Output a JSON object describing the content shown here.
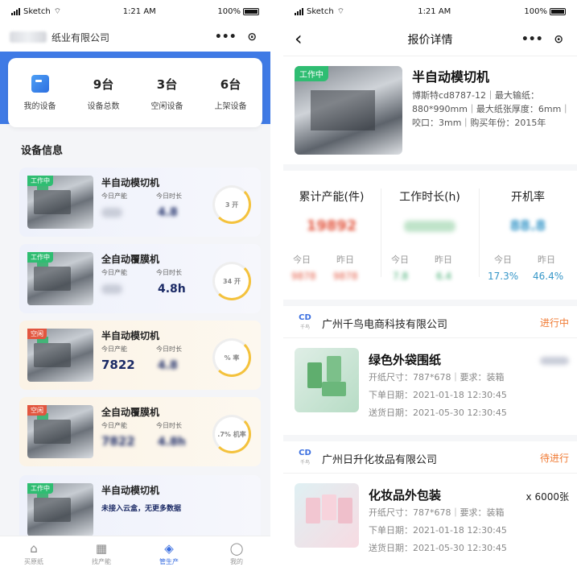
{
  "status": {
    "carrier": "Sketch",
    "time": "1:21 AM",
    "battery": "100%"
  },
  "left": {
    "header": {
      "title": "纸业有限公司",
      "more": "•••",
      "target": "⊙"
    },
    "stats": [
      {
        "num": "",
        "label": "我的设备"
      },
      {
        "num": "9台",
        "label": "设备总数"
      },
      {
        "num": "3台",
        "label": "空闲设备"
      },
      {
        "num": "6台",
        "label": "上架设备"
      }
    ],
    "section_title": "设备信息",
    "devices": [
      {
        "tag": "工作中",
        "name": "半自动模切机",
        "l1": "今日产能",
        "l2": "今日时长",
        "v1": "",
        "v2": "4.8",
        "ring": "3  开"
      },
      {
        "tag": "工作中",
        "name": "全自动覆膜机",
        "l1": "今日产能",
        "l2": "今日时长",
        "v1": "",
        "v2": "4.8h",
        "ring": "34  开"
      },
      {
        "tag": "空闲",
        "name": "半自动模切机",
        "l1": "今日产能",
        "l2": "今日时长",
        "v1": "7822",
        "v2": "4.8",
        "ring": "%  率"
      },
      {
        "tag": "空闲",
        "name": "全自动覆膜机",
        "l1": "今日产能",
        "l2": "今日时长",
        "v1": "7822",
        "v2": "4.8h",
        "ring": ".7%  机率"
      },
      {
        "tag": "工作中",
        "name": "半自动模切机",
        "note": "未接入云盒，无更多数据"
      }
    ],
    "tabs": [
      {
        "icon": "⌂",
        "label": "买原纸"
      },
      {
        "icon": "▦",
        "label": "找产能"
      },
      {
        "icon": "◈",
        "label": "管生产"
      },
      {
        "icon": "◯",
        "label": "我的"
      }
    ]
  },
  "right": {
    "header": {
      "back": "‹",
      "title": "报价详情",
      "more": "•••",
      "target": "⊙"
    },
    "product": {
      "tag": "工作中",
      "name": "半自动模切机",
      "spec": "博斯特cd8787-12｜最大输纸：880*990mm｜最大纸张厚度：6mm｜咬口：3mm｜购买年份：2015年"
    },
    "metrics": [
      {
        "title": "累计产能(件)",
        "value": "19892",
        "today_label": "今日",
        "yday_label": "昨日",
        "today": "9878",
        "yday": "9878",
        "color": "#e2563f"
      },
      {
        "title": "工作时长(h)",
        "value": "",
        "today_label": "今日",
        "yday_label": "昨日",
        "today": "7.8",
        "yday": "6.4",
        "color": "#3aa86b"
      },
      {
        "title": "开机率",
        "value": "88.8",
        "today_label": "今日",
        "yday_label": "昨日",
        "today": "17.3%",
        "yday": "46.4%",
        "color": "#3596c8"
      }
    ],
    "orders": [
      {
        "company": "广州千鸟电商科技有限公司",
        "status": "进行中",
        "name": "绿色外袋围纸",
        "qty": "",
        "size": "开纸尺寸：787*678｜要求：装箱",
        "order_date": "下单日期：2021-01-18 12:30:45",
        "ship_date": "送货日期：2021-05-30 12:30:45"
      },
      {
        "company": "广州日升化妆品有限公司",
        "status": "待进行",
        "name": "化妆品外包装",
        "qty": "x 6000张",
        "size": "开纸尺寸：787*678｜要求：装箱",
        "order_date": "下单日期：2021-01-18 12:30:45",
        "ship_date": "送货日期：2021-05-30 12:30:45"
      }
    ],
    "logo_text": "CD",
    "logo_sub": "千鸟"
  }
}
